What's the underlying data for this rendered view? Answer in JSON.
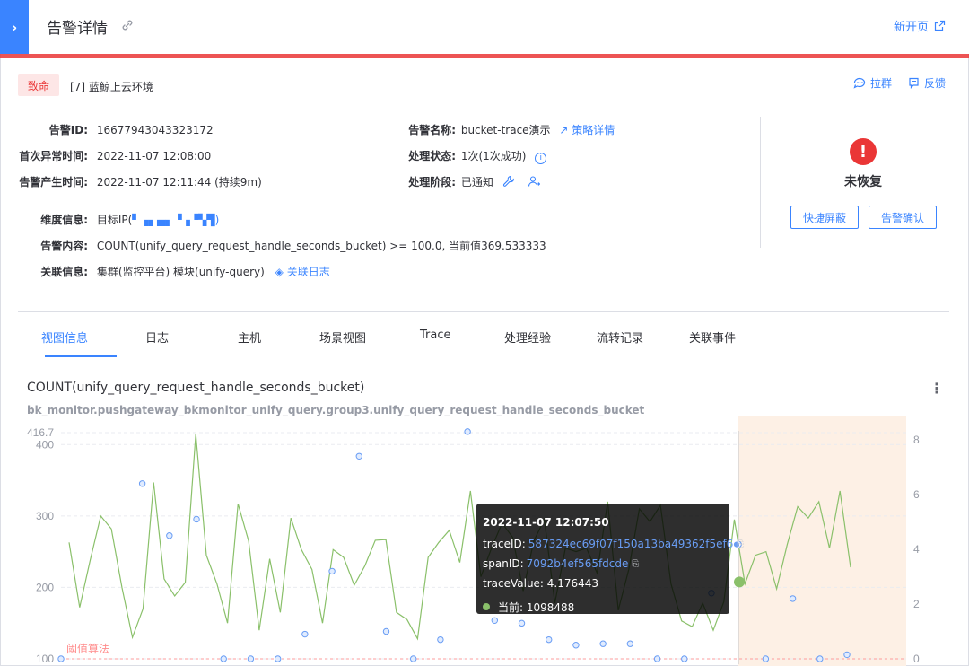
{
  "header": {
    "title": "告警详情",
    "new_page": "新开页"
  },
  "alert": {
    "severity": "致命",
    "business": "[7] 蓝鲸上云环境",
    "pull_group": "拉群",
    "feedback": "反馈",
    "fields": {
      "id_label": "告警ID:",
      "id_value": "16677943043323172",
      "first_time_label": "首次异常时间:",
      "first_time_value": "2022-11-07 12:08:00",
      "create_time_label": "告警产生时间:",
      "create_time_value": "2022-11-07 12:11:44  (持续9m)",
      "name_label": "告警名称:",
      "name_value": "bucket-trace演示",
      "strategy_link": "策略详情",
      "handle_status_label": "处理状态:",
      "handle_status_value": "1次(1次成功)",
      "handle_stage_label": "处理阶段:",
      "handle_stage_value": "已通知",
      "dimension_label": "维度信息:",
      "dimension_value": "目标IP(",
      "dimension_suffix": ")",
      "content_label": "告警内容:",
      "content_value": "COUNT(unify_query_request_handle_seconds_bucket) >= 100.0, 当前值369.533333",
      "relation_label": "关联信息:",
      "relation_value": "集群(监控平台) 模块(unify-query)",
      "related_log": "关联日志"
    },
    "status": {
      "text": "未恢复",
      "shield_button": "快捷屏蔽",
      "confirm_button": "告警确认"
    }
  },
  "tabs": [
    "视图信息",
    "日志",
    "主机",
    "场景视图",
    "Trace",
    "处理经验",
    "流转记录",
    "关联事件"
  ],
  "chart": {
    "title": "COUNT(unify_query_request_handle_seconds_bucket)",
    "subtitle": "bk_monitor.pushgateway_bkmonitor_unify_query.group3.unify_query_request_handle_seconds_bucket",
    "threshold_label": "阈值算法",
    "left_ticks": [
      "416.7",
      "400",
      "300",
      "200",
      "100"
    ],
    "right_ticks": [
      "8",
      "6",
      "4",
      "2",
      "0"
    ]
  },
  "tooltip": {
    "time": "2022-11-07 12:07:50",
    "trace_label": "traceID:",
    "trace_value": "587324ec69f07f150a13ba49362f5ef6",
    "span_label": "spanID:",
    "span_value": "7092b4ef565fdcde",
    "trace_value_text": "traceValue: 4.176443",
    "current_text": "当前: 1098488"
  },
  "colors": {
    "accent": "#3a84ff",
    "danger": "#ea3636",
    "line": "#8ac06a",
    "scatter": "#699df4",
    "alert_region": "#fdf0e5"
  },
  "chart_data": {
    "type": "line",
    "title": "COUNT(unify_query_request_handle_seconds_bucket)",
    "subtitle": "bk_monitor.pushgateway_bkmonitor_unify_query.group3.unify_query_request_handle_seconds_bucket",
    "y_left_ticks": [
      100,
      200,
      300,
      400,
      416.7
    ],
    "y_right_ticks": [
      0,
      2,
      4,
      6,
      8
    ],
    "ylim_left": [
      100,
      416.7
    ],
    "ylim_right": [
      0,
      8
    ],
    "threshold": {
      "label": "阈值算法",
      "value": 100
    },
    "line": [
      263,
      172,
      238,
      300,
      282,
      200,
      130,
      170,
      347,
      212,
      188,
      207,
      415,
      245,
      205,
      150,
      317,
      265,
      140,
      240,
      165,
      297,
      253,
      225,
      150,
      253,
      242,
      203,
      230,
      266,
      267,
      165,
      155,
      128,
      242,
      263,
      280,
      235,
      335,
      215,
      255,
      290,
      270,
      195,
      265,
      295,
      178,
      255,
      250,
      255,
      220,
      320,
      168,
      225,
      310,
      292,
      315,
      205,
      153,
      145,
      178,
      140,
      180,
      295,
      205,
      245,
      250,
      198,
      260,
      313,
      297,
      320,
      255,
      335,
      228
    ],
    "scatter": [
      {
        "x": 0,
        "y": 0
      },
      {
        "x": 3,
        "y": 6.4
      },
      {
        "x": 4,
        "y": 4.5
      },
      {
        "x": 5,
        "y": 5.1
      },
      {
        "x": 6,
        "y": 0
      },
      {
        "x": 7,
        "y": 0
      },
      {
        "x": 8,
        "y": 0
      },
      {
        "x": 9,
        "y": 0.9
      },
      {
        "x": 10,
        "y": 3.2
      },
      {
        "x": 11,
        "y": 7.4
      },
      {
        "x": 12,
        "y": 1
      },
      {
        "x": 13,
        "y": 0
      },
      {
        "x": 14,
        "y": 0.7
      },
      {
        "x": 15,
        "y": 8.3
      },
      {
        "x": 16,
        "y": 1.4
      },
      {
        "x": 17,
        "y": 1.3
      },
      {
        "x": 18,
        "y": 0.7
      },
      {
        "x": 19,
        "y": 0.5
      },
      {
        "x": 20,
        "y": 0.55
      },
      {
        "x": 21,
        "y": 0.55
      },
      {
        "x": 22,
        "y": 0
      },
      {
        "x": 23,
        "y": 0
      },
      {
        "x": 24,
        "y": 2.4
      },
      {
        "x": 25,
        "y": 4.18
      },
      {
        "x": 26,
        "y": 0
      },
      {
        "x": 27,
        "y": 2.2
      },
      {
        "x": 28,
        "y": 0
      },
      {
        "x": 29,
        "y": 0.15
      }
    ],
    "highlight": {
      "time": "2022-11-07 12:07:50",
      "trace_value": 4.176443,
      "current": 1098488
    }
  }
}
